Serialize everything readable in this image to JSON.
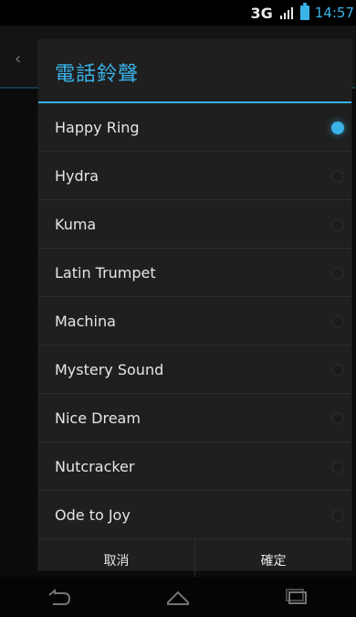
{
  "status_bar": {
    "network": "3G",
    "time": "14:57",
    "icons": [
      "signal-icon",
      "battery-icon"
    ],
    "accent": "#39b3e8"
  },
  "background": {
    "back_icon": "back-arrow-icon"
  },
  "dialog": {
    "title": "電話鈴聲",
    "items": [
      {
        "label": "Happy Ring",
        "selected": true
      },
      {
        "label": "Hydra",
        "selected": false
      },
      {
        "label": "Kuma",
        "selected": false
      },
      {
        "label": "Latin Trumpet",
        "selected": false
      },
      {
        "label": "Machina",
        "selected": false
      },
      {
        "label": "Mystery Sound",
        "selected": false
      },
      {
        "label": "Nice Dream",
        "selected": false
      },
      {
        "label": "Nutcracker",
        "selected": false
      },
      {
        "label": "Ode to Joy",
        "selected": false
      }
    ],
    "buttons": {
      "cancel": "取消",
      "ok": "確定"
    }
  },
  "nav_bar": {
    "icons": [
      "back-icon",
      "home-icon",
      "recent-apps-icon"
    ]
  }
}
